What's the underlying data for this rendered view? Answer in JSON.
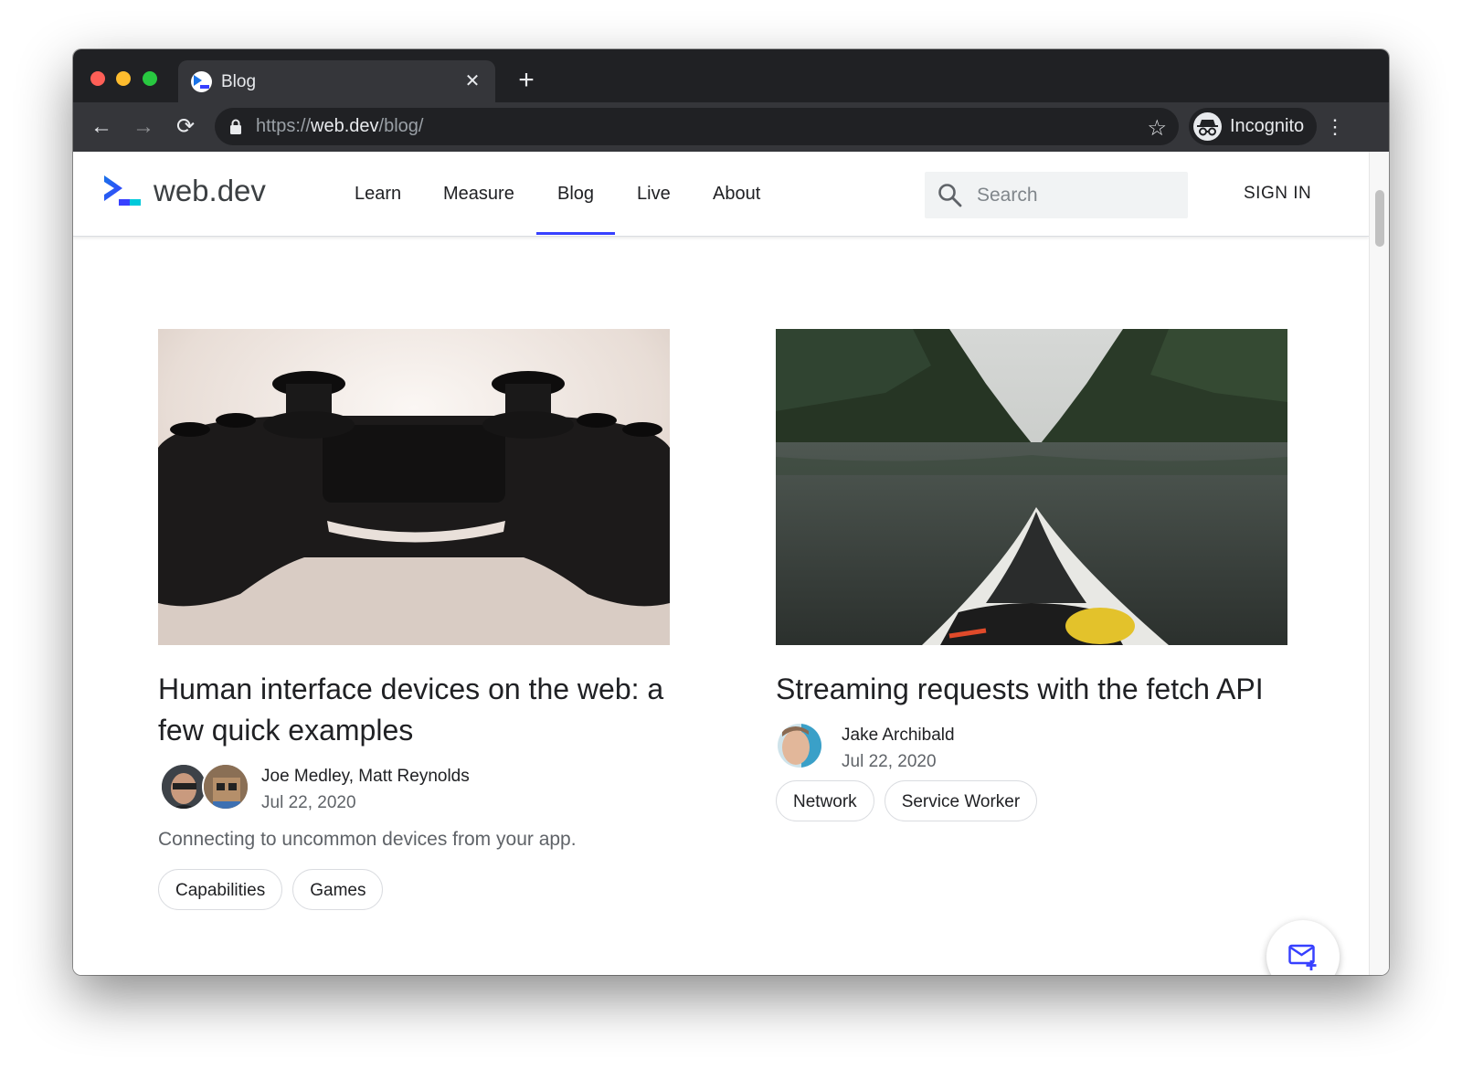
{
  "browser": {
    "tab_title": "Blog",
    "url_scheme": "https://",
    "url_host": "web.dev",
    "url_path": "/blog/",
    "profile_label": "Incognito",
    "icons": {
      "close": "close-icon",
      "new_tab": "plus-icon",
      "back": "arrow-left-icon",
      "forward": "arrow-right-icon",
      "reload": "reload-icon",
      "lock": "lock-icon",
      "bookmark": "star-icon",
      "menu": "vertical-dots-icon"
    },
    "glyphs": {
      "close": "✕",
      "new_tab": "+",
      "back": "←",
      "forward": "→",
      "reload": "⟳",
      "bookmark": "☆",
      "menu": "⋮"
    }
  },
  "site": {
    "logo_text": "web.dev",
    "nav": {
      "learn": "Learn",
      "measure": "Measure",
      "blog": "Blog",
      "live": "Live",
      "about": "About"
    },
    "active_nav": "Blog",
    "search_placeholder": "Search",
    "sign_in": "SIGN IN",
    "accent_color": "#3740ff"
  },
  "posts": [
    {
      "title": "Human interface devices on the web: a few quick examples",
      "authors": "Joe Medley, Matt Reynolds",
      "date": "Jul 22, 2020",
      "description": "Connecting to uncommon devices from your app.",
      "tags": [
        "Capabilities",
        "Games"
      ],
      "image": "game-controller-photo"
    },
    {
      "title": "Streaming requests with the fetch API",
      "authors": "Jake Archibald",
      "date": "Jul 22, 2020",
      "tags": [
        "Network",
        "Service Worker"
      ],
      "image": "kayak-on-lake-photo"
    }
  ],
  "fab": {
    "icon": "subscribe-mail-icon"
  }
}
